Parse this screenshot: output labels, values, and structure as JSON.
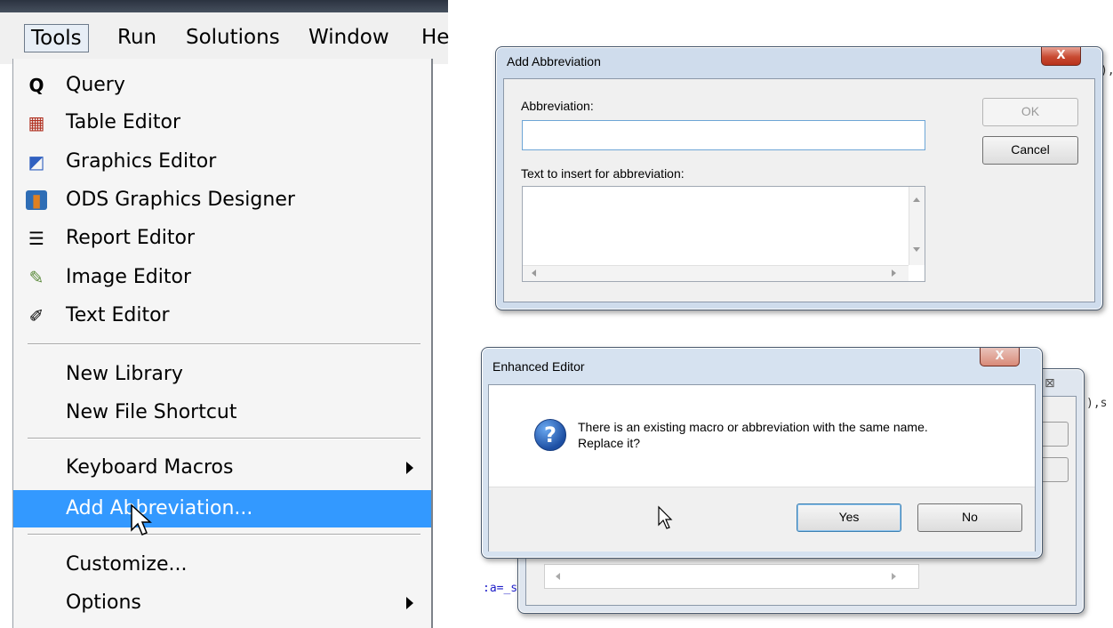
{
  "menubar": {
    "items": [
      "Tools",
      "Run",
      "Solutions",
      "Window",
      "He"
    ]
  },
  "tools_menu": {
    "items": [
      {
        "label": "Query",
        "icon": "query-icon",
        "glyph": "Q"
      },
      {
        "label": "Table Editor",
        "icon": "table-editor-icon",
        "glyph": "▦"
      },
      {
        "label": "Graphics Editor",
        "icon": "graphics-editor-icon",
        "glyph": "◩"
      },
      {
        "label": "ODS Graphics Designer",
        "icon": "ods-graphics-icon",
        "glyph": "▮"
      },
      {
        "label": "Report Editor",
        "icon": "report-editor-icon",
        "glyph": "☰"
      },
      {
        "label": "Image Editor",
        "icon": "image-editor-icon",
        "glyph": "✎"
      },
      {
        "label": "Text Editor",
        "icon": "text-editor-icon",
        "glyph": "✐"
      },
      {
        "label": "New Library"
      },
      {
        "label": "New File Shortcut"
      },
      {
        "label": "Keyboard Macros",
        "submenu": true
      },
      {
        "label": "Add Abbreviation...",
        "highlighted": true
      },
      {
        "label": "Customize..."
      },
      {
        "label": "Options",
        "submenu": true
      }
    ],
    "highlight_color": "#3399ff"
  },
  "add_abbrev_dialog": {
    "title": "Add Abbreviation",
    "abbreviation_label": "Abbreviation:",
    "abbreviation_value": "",
    "text_label": "Text to insert for abbreviation:",
    "text_value": "",
    "ok_label": "OK",
    "cancel_label": "Cancel",
    "close_glyph": "X"
  },
  "enhanced_editor_dialog": {
    "title": "Enhanced Editor",
    "message_line1": "There is an existing macro or abbreviation with the same name.",
    "message_line2": "Replace it?",
    "yes_label": "Yes",
    "no_label": "No",
    "icon": "question-icon",
    "close_glyph": "X"
  },
  "background_fragments": {
    "frag1": "),",
    "frag2": "),s",
    "frag3": ":a=_s"
  }
}
